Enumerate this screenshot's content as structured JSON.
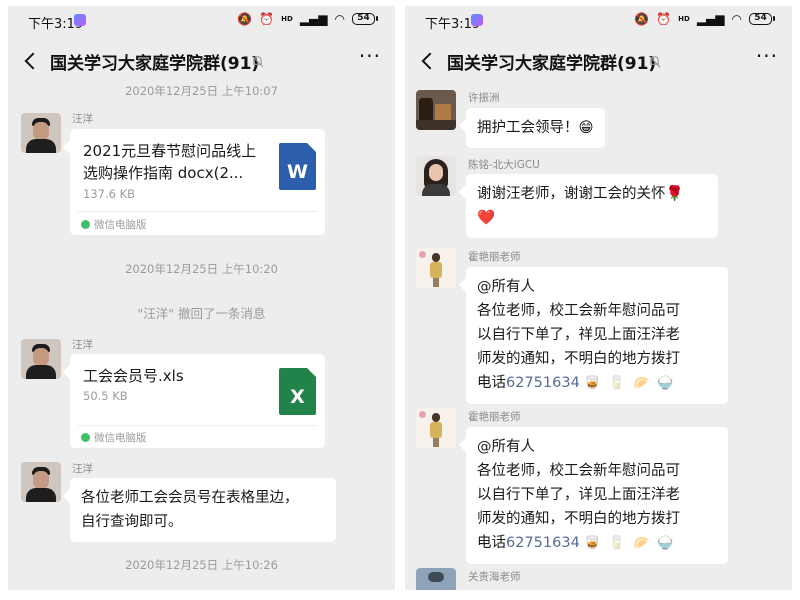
{
  "status_bar": {
    "time": "下午3:19",
    "battery": "54",
    "network": "HD"
  },
  "chat": {
    "title": "国关学习大家庭学院群(91)"
  },
  "left": {
    "timestamp_1": "2020年12月25日 上午10:07",
    "msg_1": {
      "sender": "汪洋",
      "file_name": "2021元旦春节慰问品线上\n选购操作指南 docx(2...",
      "file_size": "137.6 KB",
      "source": "微信电脑版",
      "file_type": "W"
    },
    "timestamp_2": "2020年12月25日 上午10:20",
    "recall_notice": "\"汪洋\" 撤回了一条消息",
    "msg_2": {
      "sender": "汪洋",
      "file_name": "工会会员号.xls",
      "file_size": "50.5 KB",
      "source": "微信电脑版",
      "file_type": "X"
    },
    "msg_3": {
      "sender": "汪洋",
      "text": "各位老师工会会员号在表格里边，\n自行查询即可。"
    },
    "timestamp_3": "2020年12月25日 上午10:26"
  },
  "right": {
    "msg_1": {
      "sender": "许振洲",
      "text": "拥护工会领导！😁"
    },
    "msg_2": {
      "sender": "陈铭-北大iGCU",
      "text": "谢谢汪老师，谢谢工会的关怀🌹\n❤️"
    },
    "msg_3": {
      "sender": "霍艳丽老师",
      "text": "@所有人\n各位老师，校工会新年慰问品可\n以自行下单了，祥见上面汪洋老\n师发的通知，不明白的地方拨打\n电话",
      "phone": "62751634",
      "emojis": "🥃 🥛 🥟 🍚"
    },
    "msg_4": {
      "sender": "霍艳丽老师",
      "text": "@所有人\n各位老师，校工会新年慰问品可\n以自行下单了，详见上面汪洋老\n师发的通知，不明白的地方拨打\n电话",
      "phone": "62751634",
      "emojis": "🥃 🥛 🥟 🍚"
    },
    "msg_5": {
      "sender": "关贵海老师"
    }
  },
  "icons": [
    "back-icon",
    "mute-icon",
    "more-icon",
    "alarm-icon",
    "wifi-icon",
    "battery-icon",
    "word-file-icon",
    "excel-file-icon"
  ],
  "colors": {
    "background": "#ededed",
    "bubble": "#ffffff",
    "link": "#576b95",
    "word": "#2b5fae",
    "excel": "#21824a",
    "source_dot": "#3ec16b"
  }
}
